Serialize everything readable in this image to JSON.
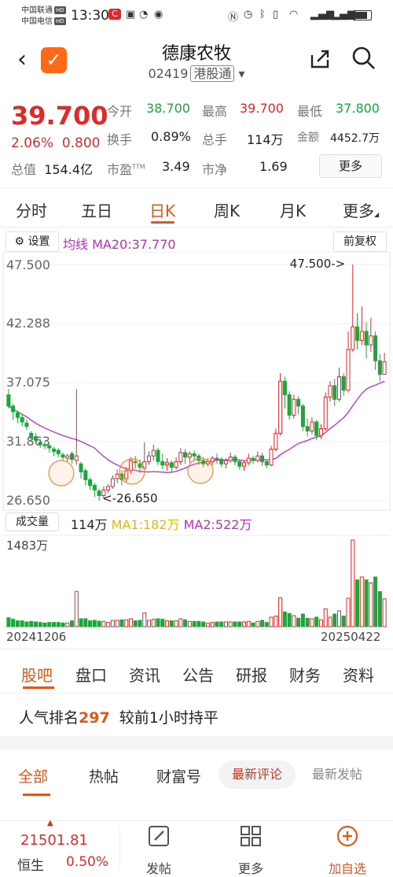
{
  "status_bar": {
    "carrier1": "中国联通",
    "carrier2": "中国电信",
    "hd": "HD",
    "time": "13:30",
    "icons": [
      "nfc-icon",
      "alarm-icon",
      "bluetooth-icon",
      "wifi-icon",
      "signal-icon",
      "signal-icon",
      "battery-icon"
    ]
  },
  "header": {
    "title": "德康农牧",
    "code": "02419",
    "tag": "港股通",
    "dropdown": "▾"
  },
  "quote": {
    "price": "39.700",
    "change_pct": "2.06%",
    "change_amt": "0.800",
    "open_label": "今开",
    "open": "38.700",
    "high_label": "最高",
    "high": "39.700",
    "low_label": "最低",
    "low": "37.800",
    "turnover_label": "换手",
    "turnover": "0.89%",
    "volume_label": "总手",
    "volume": "114万",
    "amount_label": "金额",
    "amount": "4452.7万",
    "mktcap_label": "总值",
    "mktcap": "154.4亿",
    "pe_label": "市盈",
    "pe_sup": "TTM",
    "pe": "3.49",
    "pb_label": "市净",
    "pb": "1.69",
    "more_btn": "更多"
  },
  "kline_tabs": [
    "分时",
    "五日",
    "日K",
    "周K",
    "月K",
    "更多"
  ],
  "kline_active": "日K",
  "chart_toolbar": {
    "settings": "设置",
    "ma_label": "均线",
    "ma20": "MA20:37.770",
    "adjust": "前复权"
  },
  "chart_data": {
    "type": "candlestick",
    "x_start": "20241206",
    "x_end": "20250422",
    "y_ticks": [
      "47.500",
      "42.288",
      "37.075",
      "31.863",
      "26.650"
    ],
    "ylim": [
      26.65,
      47.5
    ],
    "max_annotation": "47.500->",
    "min_annotation": "<-26.650",
    "ma20_last": 37.77,
    "candles": [
      [
        36,
        35,
        36.5,
        34.8
      ],
      [
        35,
        34.5,
        35.2,
        33.8
      ],
      [
        34.4,
        34,
        34.6,
        33.5
      ],
      [
        34,
        33.6,
        34.3,
        33.2
      ],
      [
        33.5,
        33.2,
        33.8,
        32.9
      ],
      [
        32.6,
        32.2,
        32.8,
        31.8
      ],
      [
        32.3,
        32.0,
        32.6,
        31.7
      ],
      [
        31.8,
        31.6,
        32.1,
        31.3
      ],
      [
        31.6,
        31.5,
        31.9,
        31.2
      ],
      [
        31.5,
        31.3,
        31.7,
        30.9
      ],
      [
        31.2,
        31.0,
        31.4,
        30.6
      ],
      [
        31.1,
        30.8,
        31.3,
        30.5
      ],
      [
        30.7,
        30.5,
        30.9,
        30.2
      ],
      [
        30.4,
        30.6,
        30.8,
        30.1
      ],
      [
        30.8,
        30.3,
        31.0,
        29.9
      ],
      [
        30.2,
        30.6,
        36.5,
        29.8
      ],
      [
        29.9,
        29.2,
        30.1,
        28.6
      ],
      [
        29.3,
        28.5,
        29.5,
        28.0
      ],
      [
        28.5,
        28.0,
        28.7,
        27.6
      ],
      [
        28.0,
        27.6,
        28.2,
        27.0
      ],
      [
        27.5,
        27.1,
        27.7,
        26.65
      ],
      [
        27.1,
        27.6,
        27.9,
        26.9
      ],
      [
        27.6,
        27.9,
        28.1,
        27.3
      ],
      [
        27.9,
        28.6,
        28.9,
        27.7
      ],
      [
        28.6,
        29.0,
        29.4,
        28.2
      ],
      [
        29.0,
        28.5,
        29.3,
        28.0
      ],
      [
        28.6,
        29.3,
        29.6,
        28.3
      ],
      [
        29.3,
        30.2,
        30.5,
        29.0
      ],
      [
        30.1,
        30.0,
        30.6,
        29.5
      ],
      [
        29.9,
        29.6,
        30.3,
        29.1
      ],
      [
        29.5,
        30.1,
        31.8,
        29.2
      ],
      [
        30.1,
        30.6,
        31.0,
        29.8
      ],
      [
        30.6,
        31.1,
        31.6,
        30.2
      ],
      [
        31.1,
        30.1,
        31.3,
        29.8
      ],
      [
        30.1,
        29.8,
        30.8,
        29.4
      ],
      [
        29.8,
        30.0,
        30.4,
        29.3
      ],
      [
        30.0,
        29.6,
        30.2,
        29.1
      ],
      [
        29.6,
        30.1,
        30.5,
        29.4
      ],
      [
        30.1,
        30.9,
        31.3,
        29.8
      ],
      [
        30.9,
        30.5,
        31.2,
        29.9
      ],
      [
        30.5,
        30.8,
        31.0,
        30.0
      ],
      [
        30.8,
        30.6,
        31.1,
        30.1
      ],
      [
        30.6,
        30.2,
        30.8,
        29.8
      ],
      [
        30.2,
        29.9,
        30.5,
        29.6
      ],
      [
        29.9,
        30.1,
        30.4,
        29.7
      ],
      [
        30.1,
        30.4,
        30.6,
        29.8
      ],
      [
        30.4,
        30.3,
        30.8,
        29.9
      ],
      [
        30.3,
        29.9,
        30.5,
        29.6
      ],
      [
        29.9,
        30.2,
        30.4,
        29.5
      ],
      [
        30.2,
        30.5,
        30.9,
        30.0
      ],
      [
        30.5,
        30.1,
        30.7,
        29.8
      ],
      [
        30.1,
        29.7,
        30.3,
        29.4
      ],
      [
        29.7,
        30.0,
        30.2,
        29.3
      ],
      [
        30.0,
        30.4,
        30.8,
        29.8
      ],
      [
        30.4,
        30.2,
        30.6,
        29.9
      ],
      [
        30.2,
        30.6,
        31.0,
        30.0
      ],
      [
        30.6,
        30.1,
        30.9,
        29.7
      ],
      [
        30.1,
        29.8,
        30.3,
        29.5
      ],
      [
        29.8,
        31.2,
        31.5,
        29.7
      ],
      [
        31.2,
        32.6,
        33.0,
        31.0
      ],
      [
        32.6,
        37.2,
        37.9,
        32.4
      ],
      [
        37.2,
        36.0,
        37.6,
        34.8
      ],
      [
        36.0,
        34.2,
        36.3,
        33.8
      ],
      [
        34.2,
        35.6,
        36.0,
        33.9
      ],
      [
        35.6,
        35.0,
        35.9,
        34.3
      ],
      [
        35.0,
        33.2,
        35.2,
        32.8
      ],
      [
        33.2,
        32.8,
        33.9,
        32.3
      ],
      [
        32.8,
        33.6,
        34.0,
        32.5
      ],
      [
        33.6,
        32.4,
        33.8,
        32.0
      ],
      [
        32.4,
        33.0,
        33.4,
        32.1
      ],
      [
        33.0,
        35.8,
        36.2,
        32.8
      ],
      [
        35.8,
        36.8,
        37.2,
        35.4
      ],
      [
        36.8,
        35.6,
        37.4,
        35.0
      ],
      [
        35.6,
        37.6,
        38.4,
        35.4
      ],
      [
        37.6,
        36.4,
        37.9,
        35.9
      ],
      [
        36.4,
        40.0,
        41.6,
        36.2
      ],
      [
        40.0,
        42.0,
        47.5,
        39.8
      ],
      [
        42.0,
        40.8,
        43.2,
        40.0
      ],
      [
        40.8,
        41.6,
        43.8,
        40.4
      ],
      [
        41.6,
        40.4,
        42.4,
        39.2
      ],
      [
        40.4,
        41.2,
        42.8,
        39.8
      ],
      [
        41.2,
        39.0,
        41.6,
        38.2
      ],
      [
        39.0,
        37.8,
        39.6,
        37.2
      ],
      [
        37.8,
        38.9,
        39.7,
        37.8
      ]
    ],
    "volume": {
      "label": "成交量",
      "current": "114万",
      "ma1": "MA1:182万",
      "ma2": "MA2:522万",
      "max_tick": "1483万",
      "ylim": [
        0,
        1483
      ]
    }
  },
  "section_tabs": [
    "股吧",
    "盘口",
    "资讯",
    "公告",
    "研报",
    "财务",
    "资料"
  ],
  "section_active": "股吧",
  "popularity": {
    "label": "人气排名",
    "rank": "297",
    "note": "较前1小时持平"
  },
  "feed_tabs": [
    "全部",
    "热帖",
    "财富号"
  ],
  "feed_active": "全部",
  "feed_pills": [
    "最新评论",
    "最新发帖"
  ],
  "bottom": {
    "index_value": "21501.81",
    "index_name": "恒生",
    "index_change": "0.50%",
    "actions": [
      "发帖",
      "更多",
      "加自选"
    ]
  },
  "colors": {
    "up": "#e02a2a",
    "down": "#1ea53b",
    "accent": "#e0571b",
    "ma20": "#c02ac9",
    "ma1": "#e6b800"
  }
}
